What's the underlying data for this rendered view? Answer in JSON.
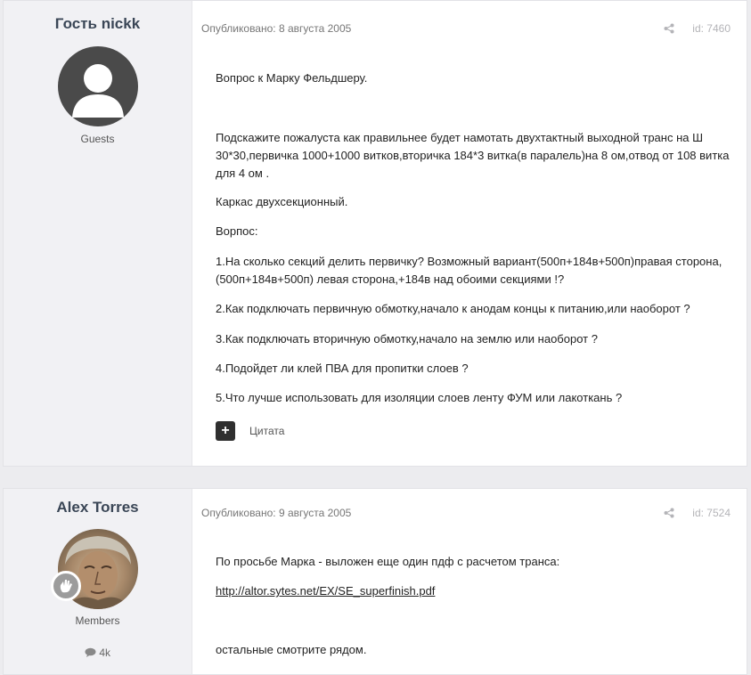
{
  "posts": [
    {
      "author": "Гость nickk",
      "group": "Guests",
      "published": "Опубликовано: 8 августа 2005",
      "id_label": "id: 7460",
      "paragraphs": [
        "Вопрос к Марку Фельдшеру.",
        "Подскажите пожалуста как правильнее будет намотать двухтактный выходной транс на Ш 30*30,первичка 1000+1000 витков,вторичка 184*3 витка(в паралель)на 8 ом,отвод от 108 витка для 4 ом .",
        "Каркас двухсекционный.",
        "Ворпос:",
        "1.На сколько секций делить первичку? Возможный вариант(500п+184в+500п)правая сторона,(500п+184в+500п) левая сторона,+184в над обоими секциями !?",
        "2.Как подключать первичную обмотку,начало к анодам концы к питанию,или наоборот ?",
        "3.Как подключать вторичную обмотку,начало на землю или наоборот ?",
        "4.Подойдет ли клей ПВА для пропитки слоев ?",
        "5.Что лучше использовать для изоляции слоев ленту ФУМ или лакоткань ?"
      ],
      "quote_label": "Цитата"
    },
    {
      "author": "Alex Torres",
      "group": "Members",
      "stat": "4k",
      "published": "Опубликовано: 9 августа 2005",
      "id_label": "id: 7524",
      "paragraphs": [
        "По просьбе Марка - выложен еще один пдф с расчетом транса:",
        "остальные смотрите рядом."
      ],
      "link": "http://altor.sytes.net/EX/SE_superfinish.pdf"
    }
  ]
}
